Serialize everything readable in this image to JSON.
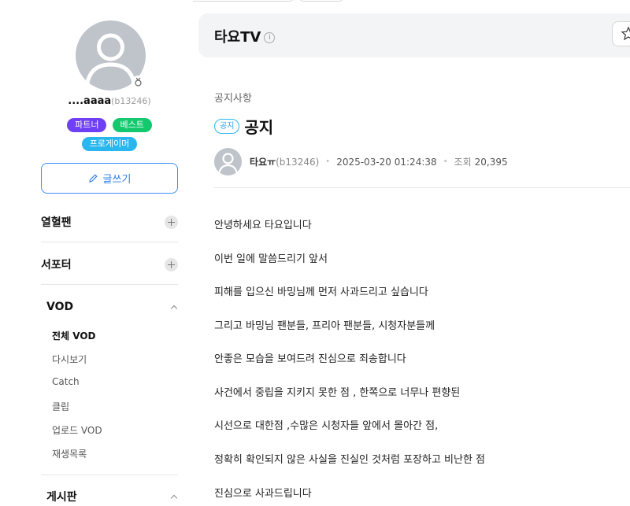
{
  "profile": {
    "username": "....aaaa",
    "user_id": "(b13246)",
    "badges": {
      "partner": "파트너",
      "best": "베스트",
      "pro": "프로게이머"
    },
    "write_button": "글쓰기"
  },
  "sidebar": {
    "sections": {
      "fans": "열혈팬",
      "supporters": "서포터",
      "vod": "VOD",
      "board": "게시판"
    },
    "vod_items": [
      "전체 VOD",
      "다시보기",
      "Catch",
      "클립",
      "업로드 VOD",
      "재생목록"
    ]
  },
  "channel": {
    "title": "타요TV",
    "info_icon": "i"
  },
  "post": {
    "board_name": "공지사항",
    "tag": "공지",
    "title": "공지",
    "author": "타요ㅠ",
    "author_id": "(b13246)",
    "datetime": "2025-03-20 01:24:38",
    "views_label": "조회",
    "views": "20,395",
    "paragraphs": [
      "안녕하세요 타요입니다",
      "이번 일에 말씀드리기 앞서",
      "피해를 입으신 바밍님께 먼저 사과드리고 싶습니다",
      "그리고 바밍님 팬분들, 프리아 팬분들, 시청자분들께",
      "안좋은 모습을 보여드려 진심으로 죄송합니다",
      "사건에서 중립을 지키지 못한 점 , 한쪽으로 너무나 편향된",
      "시선으로 대한점 ,수많은 시청자들 앞에서 몰아간 점,",
      "정확히 확인되지 않은 사실을 진실인 것처럼 포장하고 비난한 점",
      "진심으로 사과드립니다"
    ]
  },
  "colors": {
    "partner": "#6f3ff5",
    "best": "#13c86d",
    "pro": "#2ab6ef",
    "accent": "#2b7de9"
  }
}
